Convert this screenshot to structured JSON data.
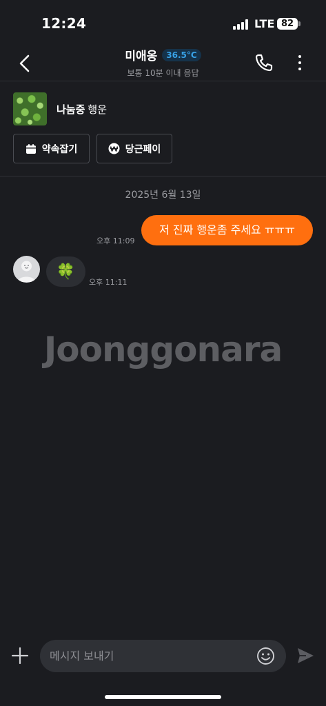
{
  "status_bar": {
    "time": "12:24",
    "network": "LTE",
    "battery": "82"
  },
  "header": {
    "name": "미애옹",
    "temperature": "36.5°C",
    "response_note": "보통 10분 이내 응답",
    "icons": {
      "back": "chevron-left-icon",
      "call": "phone-icon",
      "more": "more-vertical-icon"
    }
  },
  "item": {
    "status": "나눔중",
    "title": "행운",
    "buttons": {
      "appointment": "약속잡기",
      "pay": "당근페이"
    }
  },
  "chat": {
    "date": "2025년 6월 13일",
    "messages": [
      {
        "direction": "sent",
        "text": "저 진짜 행운좀 주세요 ㅠㅠㅠ",
        "time": "오후 11:09"
      },
      {
        "direction": "received",
        "text": "🍀",
        "time": "오후 11:11"
      }
    ]
  },
  "watermark": "Joonggonara",
  "composer": {
    "placeholder": "메시지 보내기"
  },
  "colors": {
    "background": "#1b1c20",
    "accent": "#ff6f0f",
    "temperature": "#38a3e8"
  }
}
